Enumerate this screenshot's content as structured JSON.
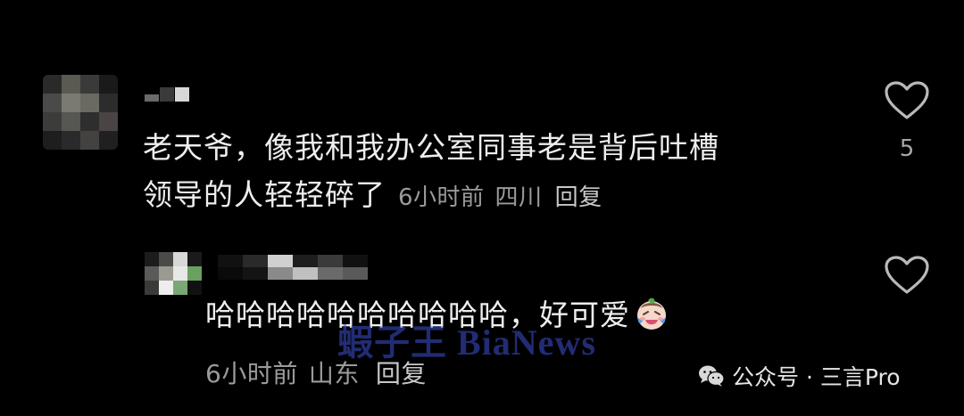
{
  "comments": [
    {
      "avatar": "blurred-avatar",
      "username": "",
      "line1": "老天爷，像我和我办公室同事老是背后吐槽",
      "line2": "领导的人轻轻碎了",
      "time": "6小时前",
      "location": "四川",
      "reply_label": "回复",
      "like_icon": "heart-outline-icon",
      "like_count": "5"
    },
    {
      "avatar": "blurred-avatar",
      "username": "",
      "text": "哈哈哈哈哈哈哈哈哈哈，好可爱",
      "emoji": "laughing-crying-baby-emoji",
      "time": "6小时前",
      "location": "山东",
      "reply_label": "回复",
      "like_icon": "heart-outline-icon"
    }
  ],
  "watermark": "蝦子王 BiaNews",
  "footer": {
    "icon": "wechat-icon",
    "source": "公众号 · 三言Pro"
  },
  "colors": {
    "background": "#000000",
    "text": "#eeeeee",
    "meta": "#9b9b9b",
    "watermark": "#3c50d2"
  }
}
